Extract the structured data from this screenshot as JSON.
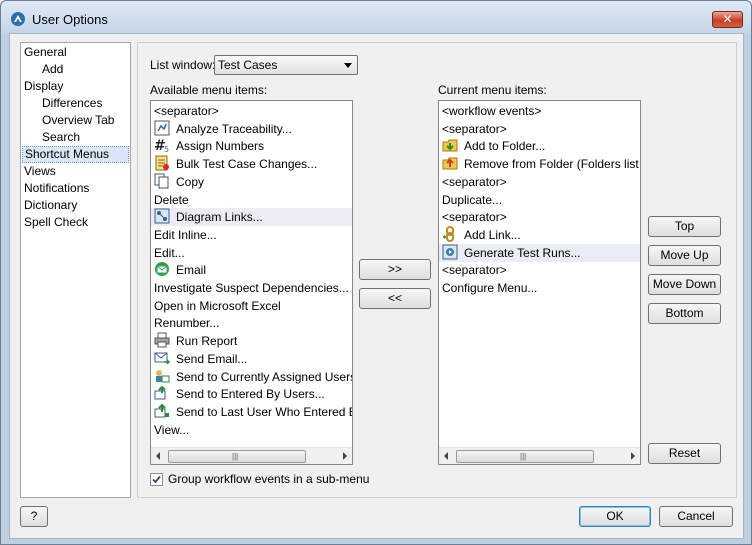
{
  "window": {
    "title": "User Options"
  },
  "nav": {
    "items": [
      {
        "label": "General",
        "indent": 0,
        "selected": false
      },
      {
        "label": "Add",
        "indent": 1,
        "selected": false
      },
      {
        "label": "Display",
        "indent": 0,
        "selected": false
      },
      {
        "label": "Differences",
        "indent": 1,
        "selected": false
      },
      {
        "label": "Overview Tab",
        "indent": 1,
        "selected": false
      },
      {
        "label": "Search",
        "indent": 1,
        "selected": false
      },
      {
        "label": "Shortcut Menus",
        "indent": 0,
        "selected": true
      },
      {
        "label": "Views",
        "indent": 0,
        "selected": false
      },
      {
        "label": "Notifications",
        "indent": 0,
        "selected": false
      },
      {
        "label": "Dictionary",
        "indent": 0,
        "selected": false
      },
      {
        "label": "Spell Check",
        "indent": 0,
        "selected": false
      }
    ]
  },
  "list_window": {
    "label": "List window:",
    "selected": "Test Cases"
  },
  "available": {
    "label": "Available menu items:",
    "items": [
      {
        "label": "<separator>",
        "icon": ""
      },
      {
        "label": "Analyze Traceability...",
        "icon": "traceability-icon"
      },
      {
        "label": "Assign Numbers",
        "icon": "number-sign-icon"
      },
      {
        "label": "Bulk Test Case Changes...",
        "icon": "bulk-changes-icon"
      },
      {
        "label": "Copy",
        "icon": "copy-icon"
      },
      {
        "label": "Delete",
        "icon": ""
      },
      {
        "label": "Diagram Links...",
        "icon": "diagram-icon"
      },
      {
        "label": "Edit Inline...",
        "icon": ""
      },
      {
        "label": "Edit...",
        "icon": ""
      },
      {
        "label": "Email",
        "icon": "email-icon"
      },
      {
        "label": "Investigate Suspect Dependencies...",
        "icon": ""
      },
      {
        "label": "Open in Microsoft Excel",
        "icon": ""
      },
      {
        "label": "Renumber...",
        "icon": ""
      },
      {
        "label": "Run Report",
        "icon": "printer-icon"
      },
      {
        "label": "Send Email...",
        "icon": "send-email-icon"
      },
      {
        "label": "Send to Currently Assigned Users",
        "icon": "send-users-icon"
      },
      {
        "label": "Send to Entered By Users...",
        "icon": "send-entered-icon"
      },
      {
        "label": "Send to Last User Who Entered Ev",
        "icon": "send-last-user-icon"
      },
      {
        "label": "View...",
        "icon": ""
      }
    ]
  },
  "current": {
    "label": "Current menu items:",
    "items": [
      {
        "label": "<workflow events>",
        "icon": ""
      },
      {
        "label": "<separator>",
        "icon": ""
      },
      {
        "label": "Add to Folder...",
        "icon": "folder-add-icon"
      },
      {
        "label": "Remove from Folder (Folders list",
        "icon": "folder-remove-icon"
      },
      {
        "label": "<separator>",
        "icon": ""
      },
      {
        "label": "Duplicate...",
        "icon": ""
      },
      {
        "label": "<separator>",
        "icon": ""
      },
      {
        "label": "Add Link...",
        "icon": "link-icon"
      },
      {
        "label": "Generate Test Runs...",
        "icon": "generate-runs-icon"
      },
      {
        "label": "<separator>",
        "icon": ""
      },
      {
        "label": "Configure Menu...",
        "icon": ""
      }
    ]
  },
  "transfer": {
    "add": ">>",
    "remove": "<<"
  },
  "order_buttons": {
    "top": "Top",
    "up": "Move Up",
    "down": "Move Down",
    "bottom": "Bottom",
    "reset": "Reset"
  },
  "options": {
    "group_label": "Group workflow events in a sub-menu",
    "group_checked": true
  },
  "footer": {
    "help": "?",
    "ok": "OK",
    "cancel": "Cancel"
  },
  "colors": {
    "accent": "#3c7fb1",
    "selection": "#d9e7f7"
  }
}
